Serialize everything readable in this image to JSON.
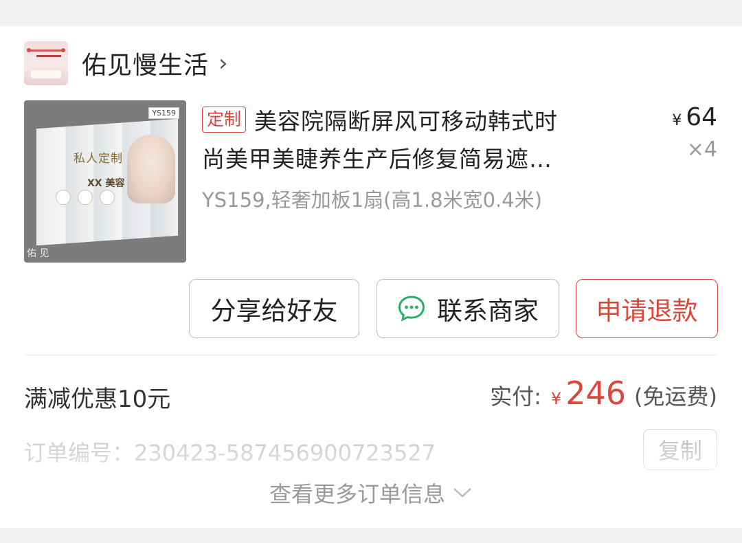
{
  "shop": {
    "name": "佑见慢生活",
    "chevron": "›",
    "avatar_icon": "shop-avatar-image"
  },
  "product": {
    "image_tag": "YS159",
    "image_title": "私人定制",
    "image_xx": "XX 美容",
    "image_watermark": "佑 见",
    "badge": "定制",
    "title_line1": "美容院隔断屏风可移动韩式时",
    "title_line2": "尚美甲美睫养生产后修复简易遮…",
    "spec": "YS159,轻奢加板1扇(高1.8米宽0.4米)",
    "price_symbol": "¥",
    "price": "64",
    "quantity": "×4"
  },
  "actions": {
    "share_label": "分享给好友",
    "contact_label": "联系商家",
    "refund_label": "申请退款"
  },
  "summary": {
    "discount": "满减优惠10元",
    "paid_label": "实付:",
    "paid_symbol": "¥",
    "paid_amount": "246",
    "shipping": "(免运费)"
  },
  "order": {
    "number_text": "订单编号：230423-587456900723527",
    "copy_label": "复制",
    "more_label": "查看更多订单信息"
  },
  "colors": {
    "accent": "#d9463c",
    "wechat_green": "#2aae67"
  }
}
